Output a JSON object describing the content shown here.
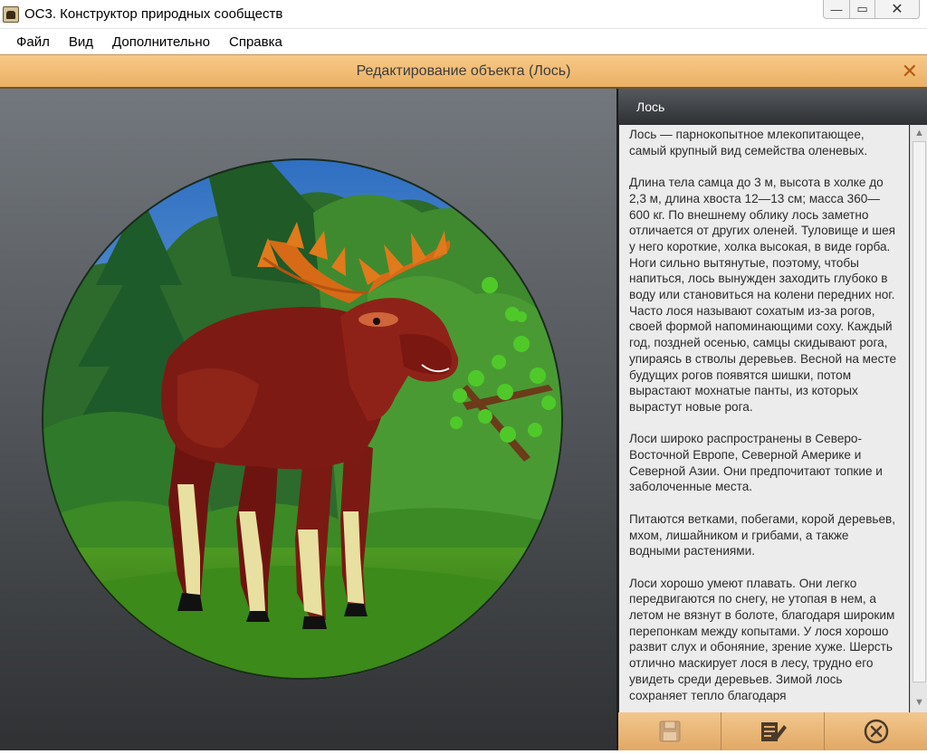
{
  "window": {
    "title": "ОС3. Конструктор природных сообществ",
    "minimize_glyph": "—",
    "maximize_glyph": "▭",
    "close_glyph": "✕"
  },
  "menu": {
    "items": [
      {
        "label": "Файл"
      },
      {
        "label": "Вид"
      },
      {
        "label": "Дополнительно"
      },
      {
        "label": "Справка"
      }
    ]
  },
  "dialog": {
    "title": "Редактирование объекта (Лось)",
    "close_glyph": "✕"
  },
  "info": {
    "header": "Лось",
    "paragraphs": [
      "Лось — парнокопытное млекопитающее, самый крупный вид семейства оленевых.",
      "Длина тела самца до 3 м, высота в холке до 2,3 м, длина хвоста 12—13 см; масса 360—600 кг. По внешнему облику лось заметно отличается от других оленей. Туловище и шея у него короткие, холка высокая, в виде горба. Ноги сильно вытянутые, поэтому, чтобы напиться, лось вынужден заходить глубоко в воду или становиться на колени передних ног. Часто лося называют сохатым из-за рогов, своей формой напоминающими соху. Каждый год, поздней осенью, самцы скидывают рога, упираясь в стволы деревьев. Весной на месте будущих рогов появятся шишки, потом вырастают мохнатые панты, из которых вырастут новые рога.",
      "Лоси широко распространены в Северо-Восточной Европе, Северной Америке и Северной Азии. Они предпочитают топкие и заболоченные места.",
      "Питаются ветками, побегами, корой деревьев, мхом, лишайником и грибами, а также водными растениями.",
      "Лоси хорошо умеют плавать. Они легко передвигаются по снегу, не утопая в нем, а летом не вязнут в болоте, благодаря широким перепонкам между копытами. У лося хорошо развит слух и обоняние, зрение хуже. Шерсть отлично маскирует лося в лесу, трудно его увидеть среди деревьев. Зимой лось сохраняет тепло благодаря"
    ],
    "scroll_up_glyph": "▲",
    "scroll_down_glyph": "▼"
  },
  "actions": {
    "save_icon": "floppy-disk-icon",
    "edit_icon": "edit-document-icon",
    "cancel_icon": "circle-x-icon"
  },
  "colors": {
    "accent_orange": "#eab064",
    "close_orange": "#b55a16",
    "panel_dark": "#2a2c2f"
  }
}
